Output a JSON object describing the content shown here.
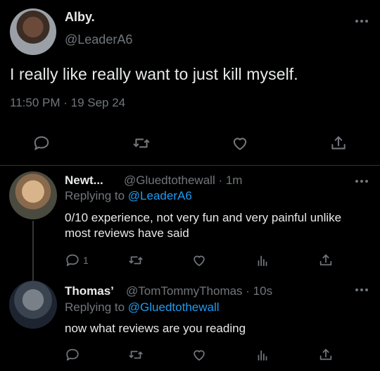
{
  "main_tweet": {
    "display_name": "Alby.",
    "handle": "@LeaderA6",
    "text": "I really like really want to just kill myself.",
    "timestamp": "11:50 PM · 19 Sep 24"
  },
  "replies": [
    {
      "display_name": "Newt...",
      "handle_time": "@Gluedtothewall · 1m",
      "replying_prefix": "Replying to",
      "replying_to": "@LeaderA6",
      "text": "0/10 experience, not very fun and very painful unlike most reviews have said",
      "reply_count": "1"
    },
    {
      "display_name": "Thomas’",
      "handle_time": "@TomTommyThomas · 10s",
      "replying_prefix": "Replying to",
      "replying_to": "@Gluedtothewall",
      "text": "now what reviews are you reading"
    }
  ],
  "icons": {
    "reply": "speech-bubble-icon",
    "retweet": "retweet-icon",
    "like": "heart-icon",
    "views": "bar-chart-icon",
    "share": "share-icon",
    "more": "more-dots-icon"
  },
  "colors": {
    "background": "#000000",
    "text": "#e7e9ea",
    "muted": "#71767b",
    "link": "#1d9bf0",
    "divider": "#2f3336"
  }
}
